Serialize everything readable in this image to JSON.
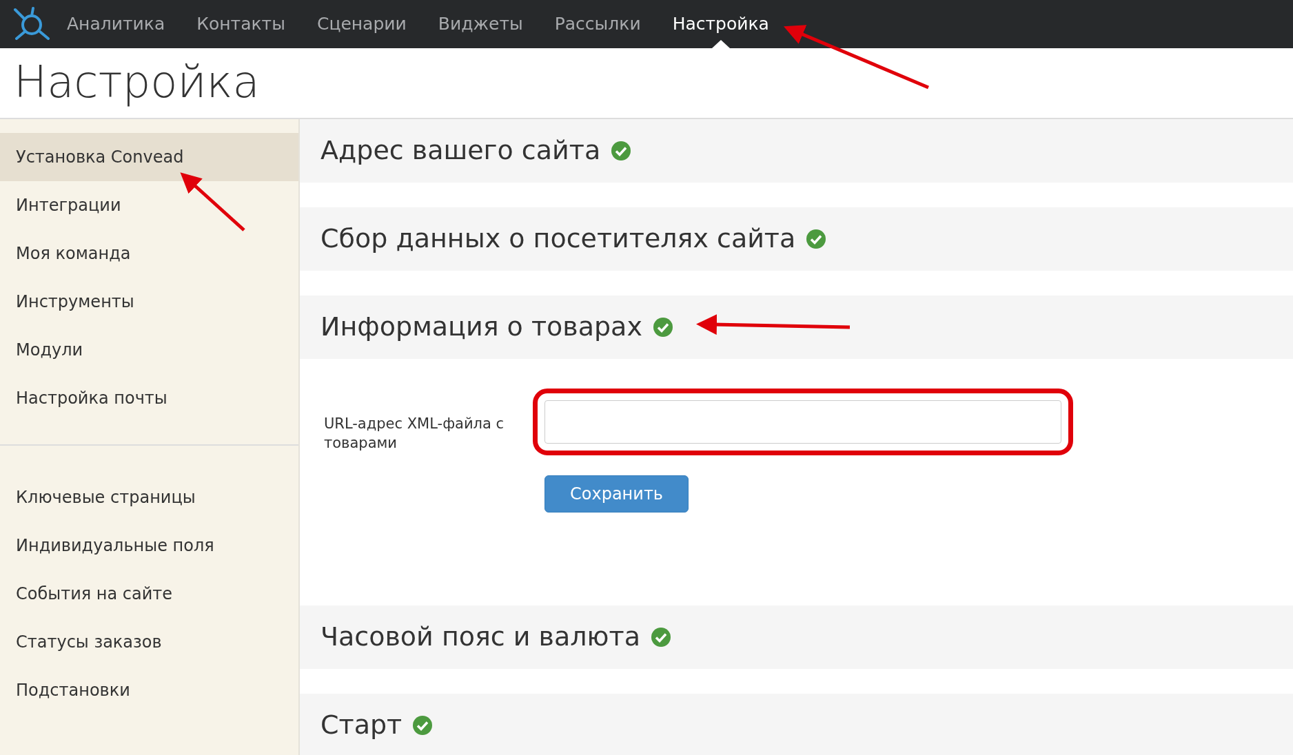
{
  "navbar": {
    "items": [
      {
        "label": "Аналитика",
        "selected": false
      },
      {
        "label": "Контакты",
        "selected": false
      },
      {
        "label": "Сценарии",
        "selected": false
      },
      {
        "label": "Виджеты",
        "selected": false
      },
      {
        "label": "Рассылки",
        "selected": false
      },
      {
        "label": "Настройка",
        "selected": true
      }
    ]
  },
  "page_title": "Настройка",
  "sidebar": {
    "groups": [
      {
        "items": [
          {
            "label": "Установка Convead",
            "selected": true
          },
          {
            "label": "Интеграции",
            "selected": false
          },
          {
            "label": "Моя команда",
            "selected": false
          },
          {
            "label": "Инструменты",
            "selected": false
          },
          {
            "label": "Модули",
            "selected": false
          },
          {
            "label": "Настройка почты",
            "selected": false
          }
        ]
      },
      {
        "items": [
          {
            "label": "Ключевые страницы",
            "selected": false
          },
          {
            "label": "Индивидуальные поля",
            "selected": false
          },
          {
            "label": "События на сайте",
            "selected": false
          },
          {
            "label": "Статусы заказов",
            "selected": false
          },
          {
            "label": "Подстановки",
            "selected": false
          }
        ]
      }
    ]
  },
  "sections": [
    {
      "title": "Адрес вашего сайта",
      "done": true,
      "expanded": false
    },
    {
      "title": "Сбор данных о посетителях сайта",
      "done": true,
      "expanded": false
    },
    {
      "title": "Информация о товарах",
      "done": true,
      "expanded": true,
      "form": {
        "label": "URL-адрес XML-файла с товарами",
        "button": "Сохранить"
      }
    },
    {
      "title": "Часовой пояс и валюта",
      "done": true,
      "expanded": false
    },
    {
      "title": "Старт",
      "done": true,
      "expanded": false
    }
  ]
}
